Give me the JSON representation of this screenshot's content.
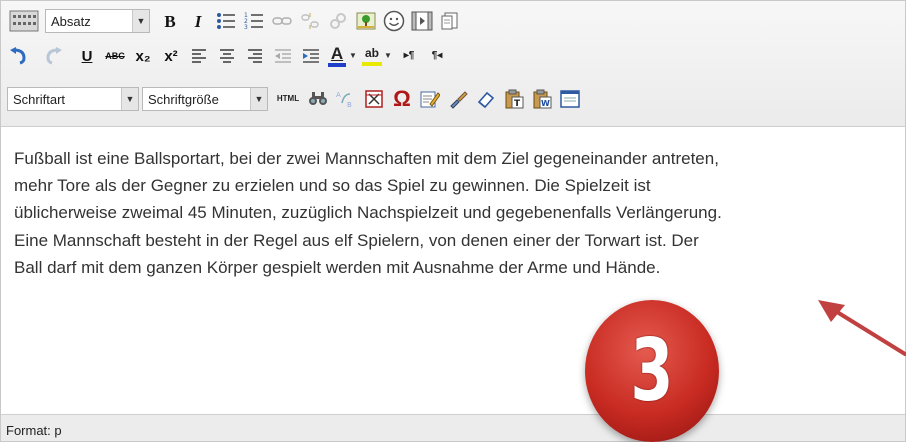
{
  "toolbar": {
    "block_format": "Absatz",
    "font_family": "Schriftart",
    "font_size": "Schriftgröße",
    "html_label": "HTML",
    "bold_label": "B",
    "italic_label": "I",
    "underline_label": "U",
    "strikethrough_label": "ABC",
    "subscript_label": "x₂",
    "superscript_label": "x²",
    "text_color_label": "A",
    "highlight_label": "ab",
    "special_char_label": "Ω",
    "ltr_label": "▸¶",
    "rtl_label": "¶◂",
    "icons_row1": [
      "toolbar-toggle-icon",
      "unordered-list-icon",
      "ordered-list-icon",
      "link-icon",
      "unlink-icon",
      "anchor-icon",
      "image-icon",
      "emoticon-icon",
      "media-icon",
      "template-icon"
    ],
    "icons_row2": [
      "undo-icon",
      "redo-icon",
      "align-left-icon",
      "align-center-icon",
      "align-right-icon",
      "outdent-icon",
      "indent-icon"
    ],
    "icons_row3": [
      "find-icon",
      "replace-icon",
      "page-break-icon",
      "edit-icon",
      "format-painter-icon",
      "clear-format-icon",
      "paste-text-icon",
      "paste-word-icon",
      "fullscreen-icon"
    ]
  },
  "content": {
    "lines": [
      "Fußball ist eine Ballsportart, bei der zwei Mannschaften mit dem Ziel gegeneinander antreten,",
      "mehr Tore als der Gegner zu erzielen und so das Spiel zu gewinnen. Die Spielzeit ist",
      "üblicherweise zweimal 45 Minuten, zuzüglich Nachspielzeit und gegebenenfalls Verlängerung.",
      "Eine Mannschaft besteht in der Regel aus elf Spielern, von denen einer der Torwart ist. Der",
      "Ball darf mit dem ganzen Körper gespielt werden mit Ausnahme der Arme und Hände."
    ]
  },
  "status": {
    "format": "Format: p"
  },
  "annotation": {
    "number": "3"
  },
  "colors": {
    "badge": "#c82b22",
    "arrow": "#c0413f",
    "text_color_bar": "#1f3fc8",
    "highlight_bar": "#e8e800"
  }
}
